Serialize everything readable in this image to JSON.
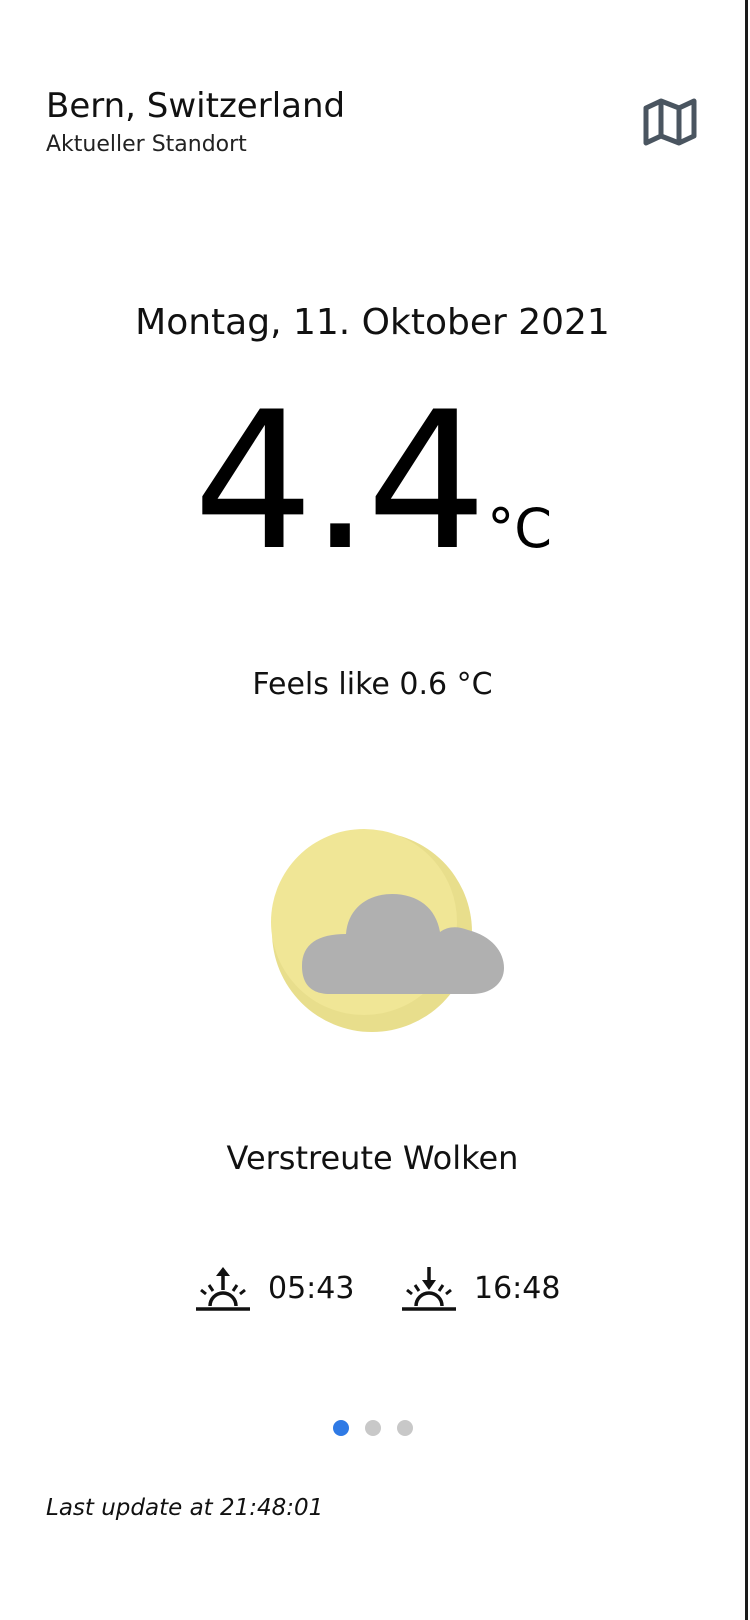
{
  "location": {
    "city": "Bern, Switzerland",
    "subtitle": "Aktueller Standort"
  },
  "actions": {
    "map_icon": "map-icon"
  },
  "weather": {
    "date": "Montag, 11. Oktober 2021",
    "temperature": "4.4",
    "unit": "°C",
    "feels_like": "Feels like 0.6 °C",
    "icon": "partly-cloudy-night-icon",
    "condition": "Verstreute Wolken",
    "sunrise": "05:43",
    "sunset": "16:48"
  },
  "pager": {
    "pages": 3,
    "active_index": 0
  },
  "footer": {
    "last_update": "Last update at 21:48:01"
  },
  "colors": {
    "moon": "#f0e696",
    "moon_shadow": "#e8de8c",
    "cloud": "#b0b0b0",
    "dot_active": "#2f7ae5",
    "dot_inactive": "#c8c8c8",
    "map_icon": "#4a5560"
  }
}
